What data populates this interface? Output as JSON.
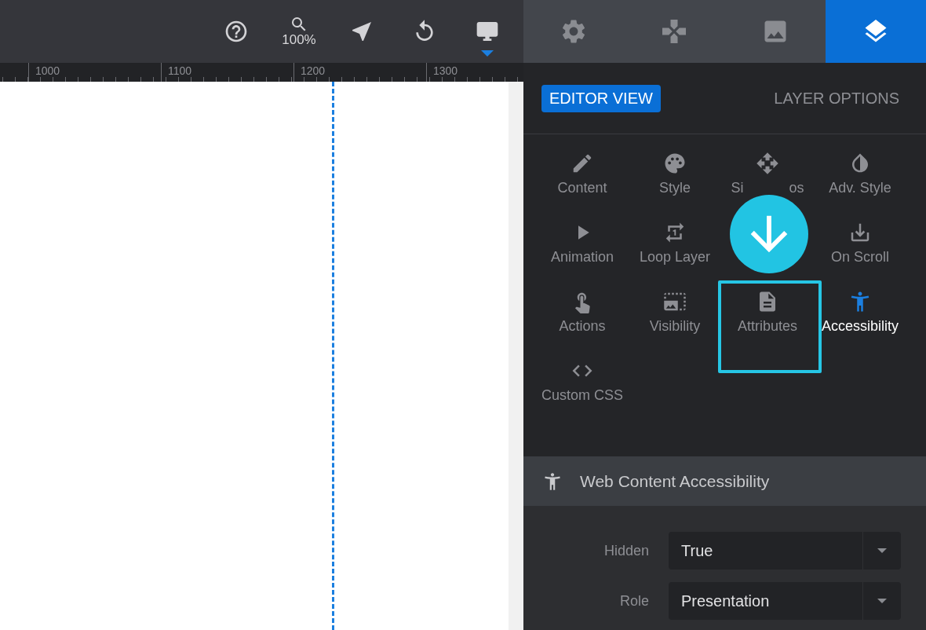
{
  "toolbar": {
    "tools": [
      {
        "kind": "help",
        "selected": false
      },
      {
        "kind": "zoom",
        "label": "100%",
        "selected": false
      },
      {
        "kind": "select",
        "selected": false
      },
      {
        "kind": "undo",
        "selected": false
      },
      {
        "kind": "desktop",
        "selected": true
      }
    ]
  },
  "panel_tabs": [
    {
      "selected": false
    },
    {
      "selected": false
    },
    {
      "selected": false
    },
    {
      "selected": true
    }
  ],
  "ruler": {
    "labels": [
      "1000",
      "1100",
      "1200",
      "1300"
    ]
  },
  "mode_tabs": [
    {
      "label": "EDITOR VIEW",
      "selected": true
    },
    {
      "label": "LAYER OPTIONS",
      "selected": false
    }
  ],
  "options": [
    {
      "kind": "item",
      "label": "Content",
      "selected": false,
      "highlighted": false
    },
    {
      "kind": "item",
      "label": "Style",
      "selected": false,
      "highlighted": false
    },
    {
      "kind": "partly_covered",
      "label_parts": [
        "Si",
        "os"
      ]
    },
    {
      "kind": "item",
      "label": "Adv. Style",
      "selected": false,
      "highlighted": false
    },
    {
      "kind": "item",
      "label": "Animation",
      "selected": false,
      "highlighted": false
    },
    {
      "kind": "item",
      "label": "Loop Layer",
      "selected": false,
      "highlighted": false
    },
    {
      "kind": "covered"
    },
    {
      "kind": "item",
      "label": "On Scroll",
      "selected": false,
      "highlighted": false
    },
    {
      "kind": "item",
      "label": "Actions",
      "selected": false,
      "highlighted": false
    },
    {
      "kind": "item",
      "label": "Visibility",
      "selected": false,
      "highlighted": false
    },
    {
      "kind": "item",
      "label": "Attributes",
      "selected": false,
      "highlighted": true
    },
    {
      "kind": "item",
      "label": "Accessibility",
      "selected": true,
      "highlighted": false
    },
    {
      "kind": "item",
      "label": "Custom CSS",
      "selected": false,
      "highlighted": false
    }
  ],
  "section": {
    "title": "Web Content Accessibility"
  },
  "fields": [
    {
      "label": "Hidden",
      "value": "True"
    },
    {
      "label": "Role",
      "value": "Presentation"
    }
  ]
}
